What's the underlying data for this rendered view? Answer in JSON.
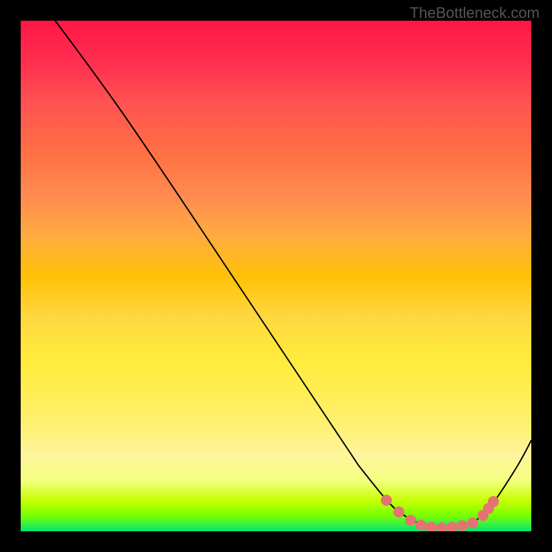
{
  "watermark": "TheBottleneck.com",
  "chart_data": {
    "type": "line",
    "title": "",
    "xlabel": "",
    "ylabel": "",
    "xlim": [
      0,
      100
    ],
    "ylim": [
      0,
      100
    ],
    "description": "Bottleneck curve on a red-to-green gradient background. A descending black curve starts near the top-left, falls diagonally, reaches a minimum basin around x≈75-85, then rises toward the right edge. Salmon-colored dots highlight the basin region.",
    "series": [
      {
        "name": "bottleneck-curve",
        "x": [
          7,
          20,
          35,
          51,
          66,
          72,
          76,
          80,
          84,
          88,
          92,
          97,
          100
        ],
        "y": [
          100,
          82,
          60,
          35,
          13,
          6,
          2,
          1,
          0.7,
          1,
          4,
          13,
          18
        ]
      }
    ],
    "highlighted_points": {
      "name": "data-dots",
      "x": [
        72,
        74,
        76,
        78,
        80,
        82,
        85,
        87,
        89,
        91,
        92,
        93
      ],
      "y": [
        6,
        4,
        2.5,
        1.5,
        1,
        0.7,
        0.8,
        1,
        1.5,
        3,
        4.5,
        6
      ]
    },
    "gradient_stops": [
      {
        "pos": 0,
        "color": "#ff1744"
      },
      {
        "pos": 50,
        "color": "#ffc107"
      },
      {
        "pos": 85,
        "color": "#fff59d"
      },
      {
        "pos": 100,
        "color": "#00e676"
      }
    ]
  }
}
